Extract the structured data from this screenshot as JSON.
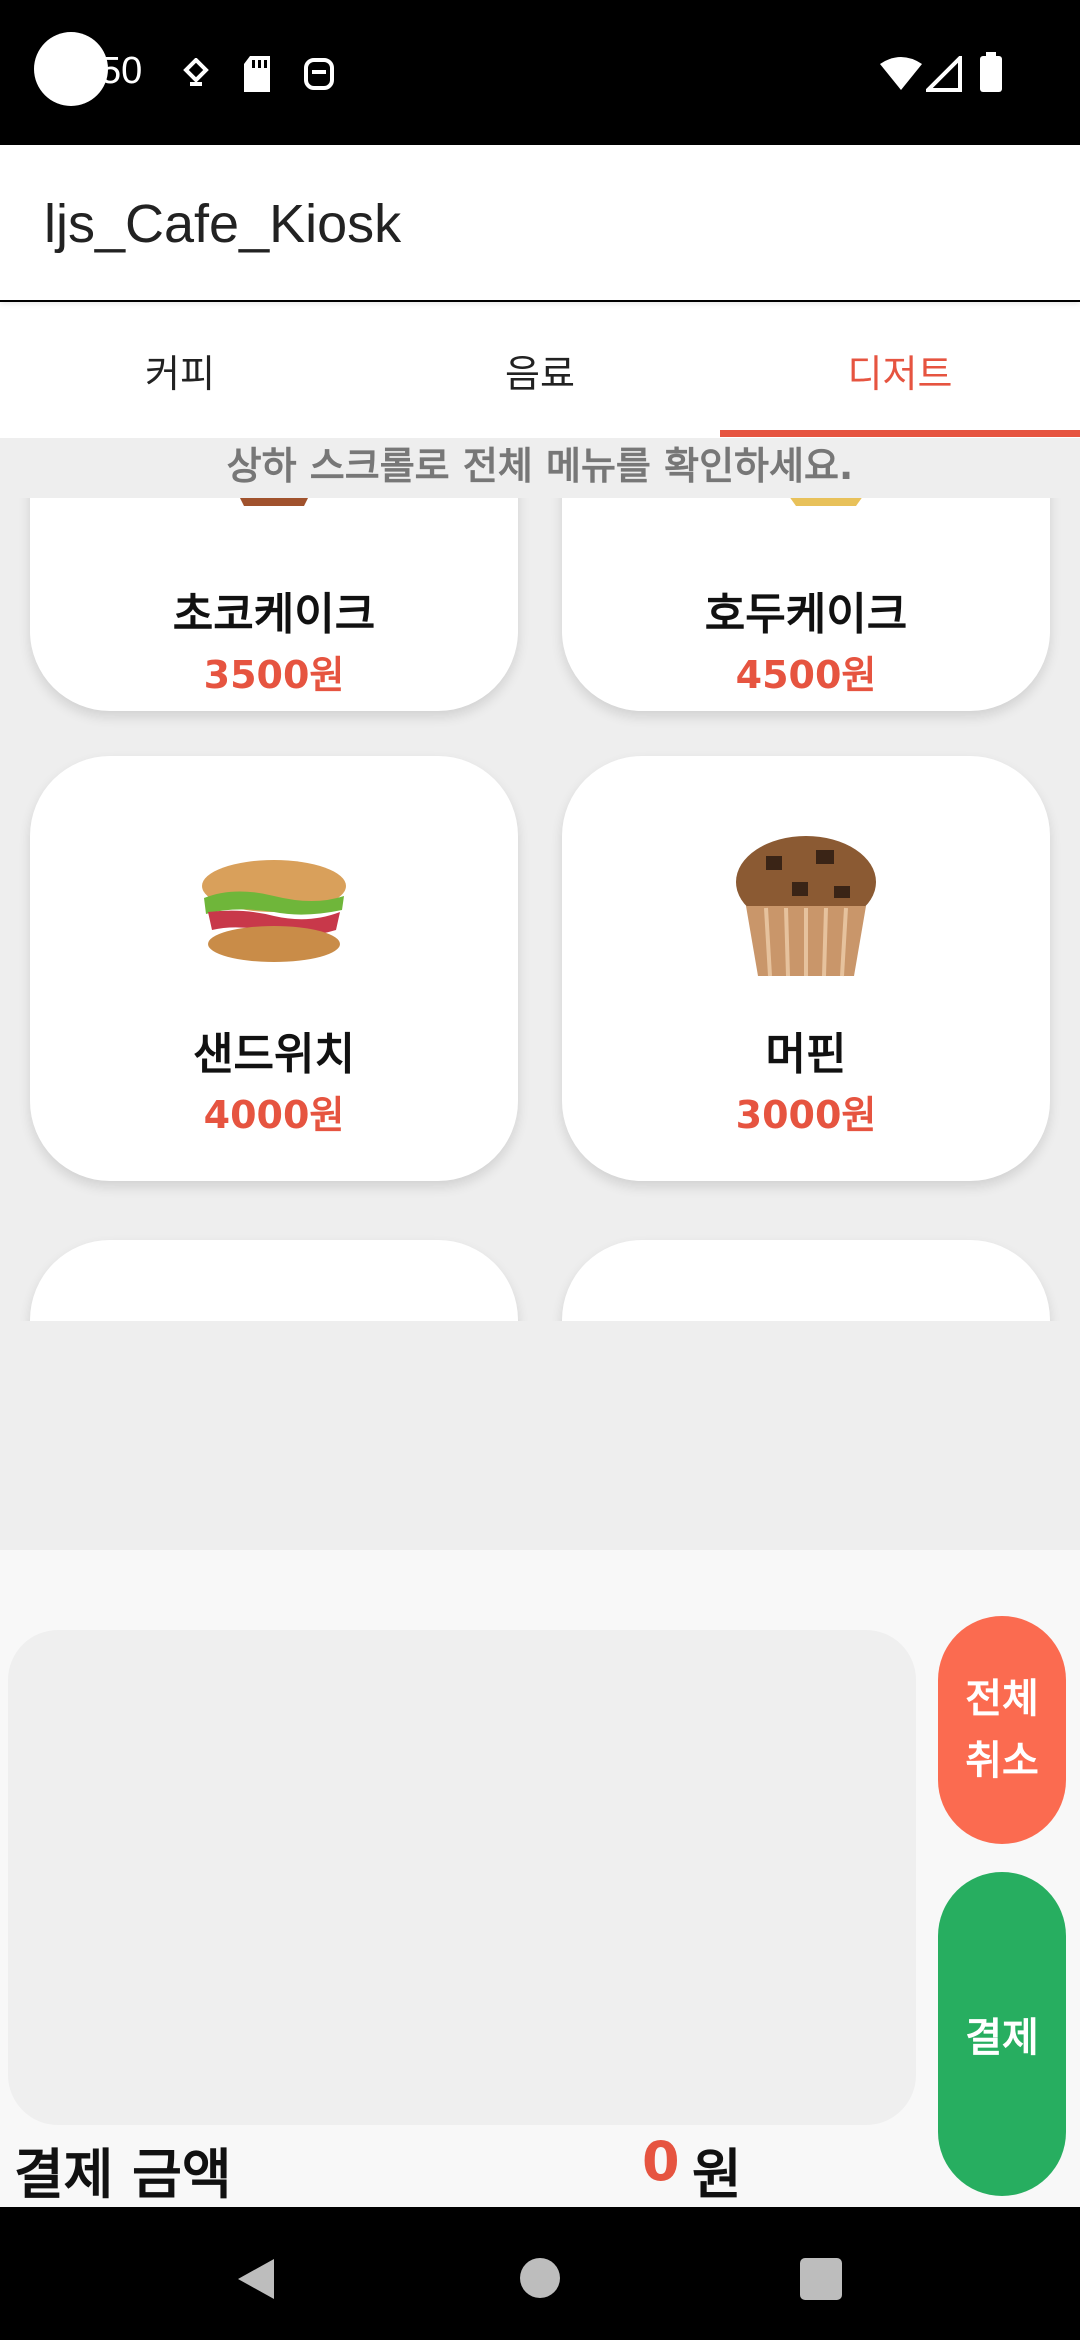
{
  "status_bar": {
    "time": "50",
    "icons": [
      "camera-cutout",
      "notification-icon",
      "sd-card-icon",
      "face-icon",
      "wifi-icon",
      "signal-icon",
      "battery-icon"
    ]
  },
  "app": {
    "title": "ljs_Cafe_Kiosk"
  },
  "tabs": [
    {
      "label": "커피",
      "active": false
    },
    {
      "label": "음료",
      "active": false
    },
    {
      "label": "디저트",
      "active": true
    }
  ],
  "menu": {
    "hint": "상하 스크롤로 전체 메뉴를 확인하세요.",
    "items": [
      {
        "name": "초코케이크",
        "price": "3500원"
      },
      {
        "name": "호두케이크",
        "price": "4500원"
      },
      {
        "name": "샌드위치",
        "price": "4000원"
      },
      {
        "name": "머핀",
        "price": "3000원"
      }
    ]
  },
  "cart": {
    "cancel_label": "전체 취소",
    "pay_label": "결제",
    "total_label": "결제 금액",
    "total_amount": "0",
    "total_unit": "원"
  },
  "colors": {
    "accent": "#e65440",
    "cancel": "#fb6b50",
    "pay": "#27ae60"
  }
}
